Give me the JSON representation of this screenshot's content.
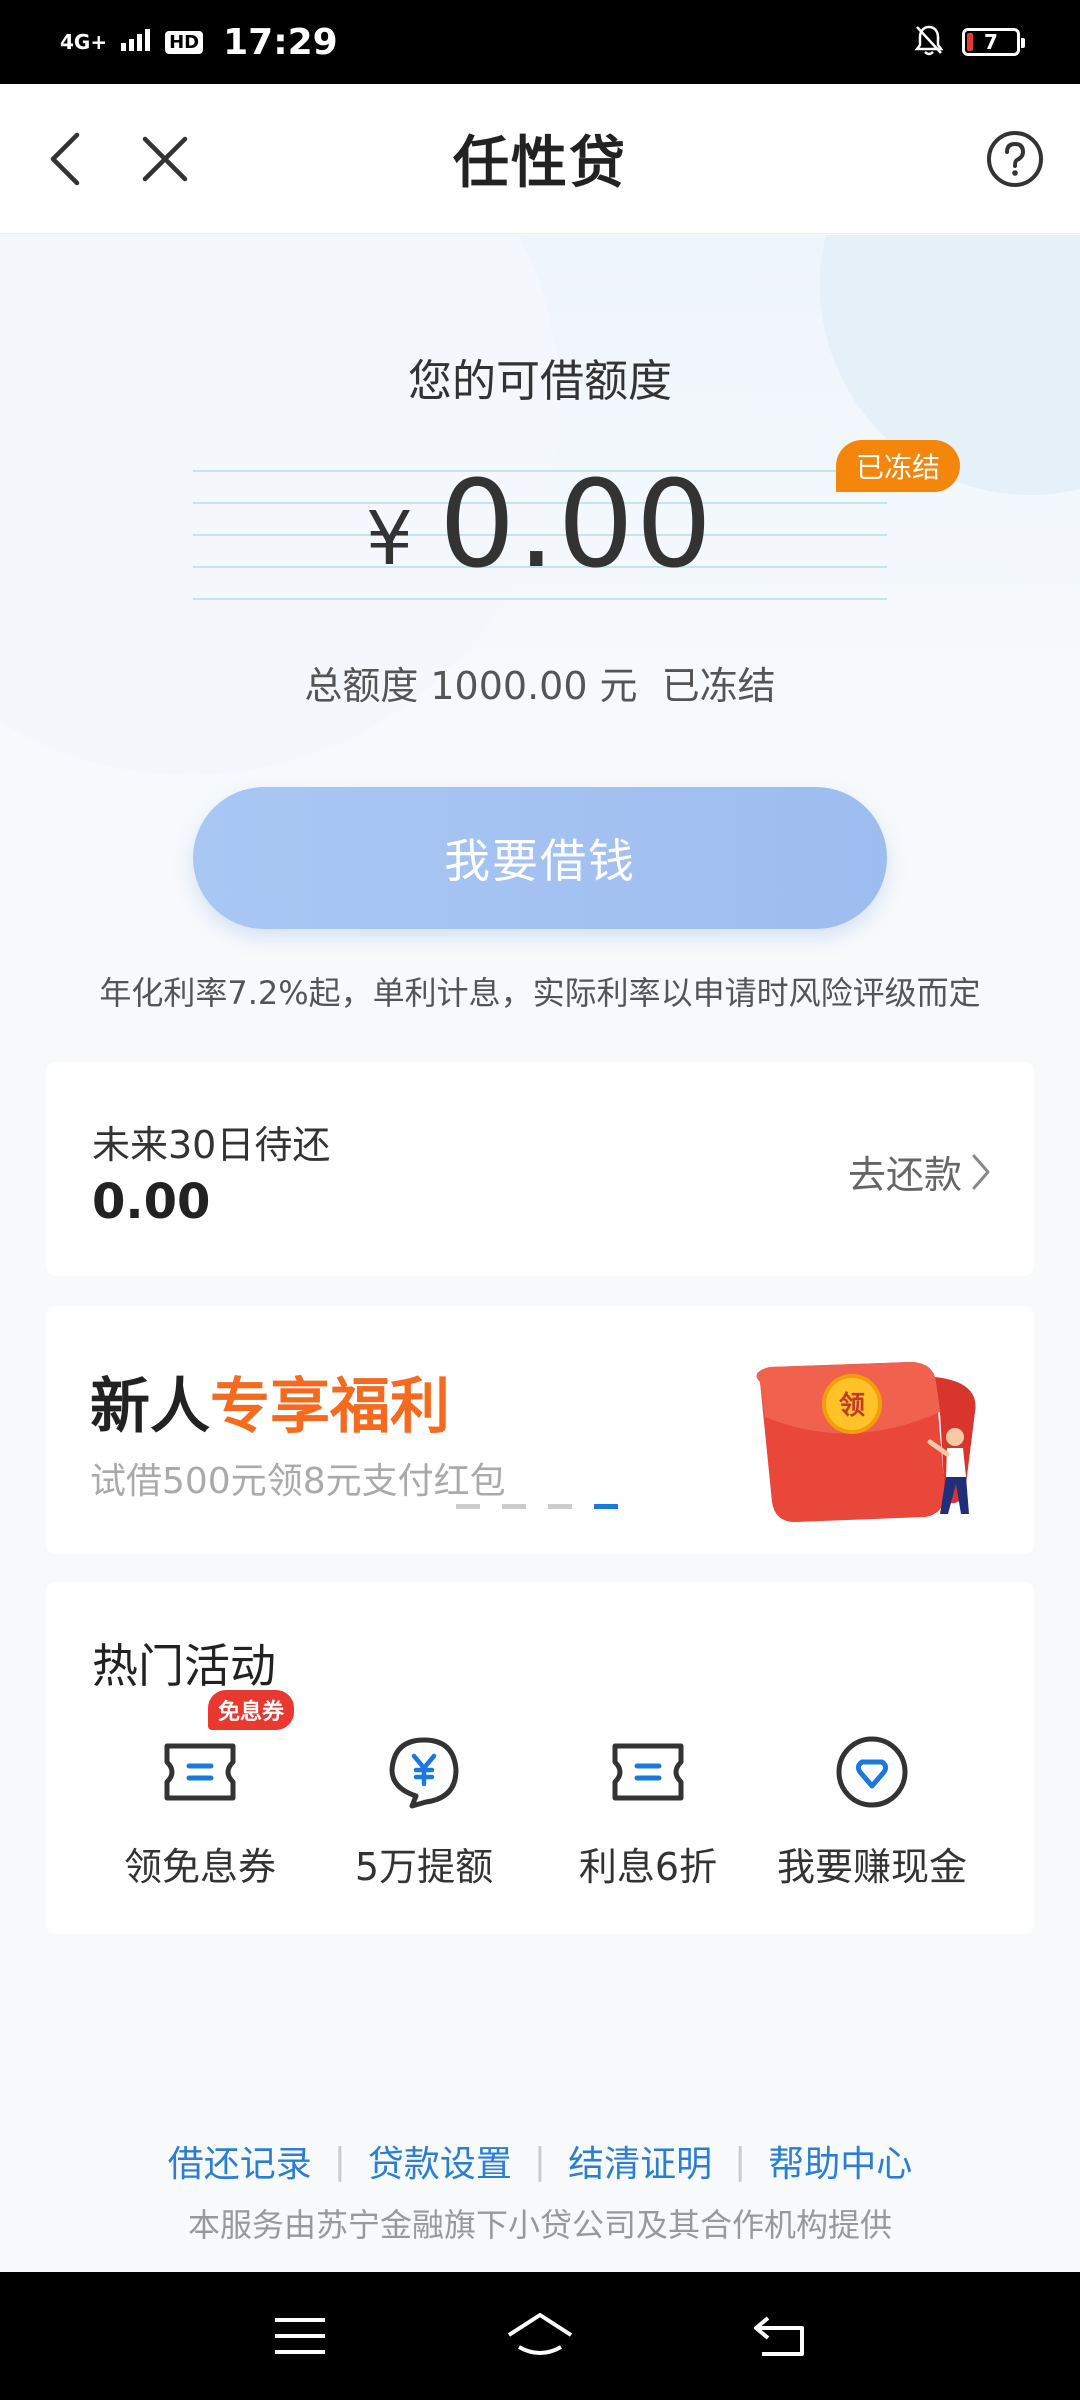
{
  "status_bar": {
    "network": "4G+",
    "hd": "HD",
    "time": "17:29",
    "battery": "7"
  },
  "header": {
    "title": "任性贷"
  },
  "hero": {
    "quota_label": "您的可借额度",
    "currency": "¥",
    "amount": "0.00",
    "badge": "已冻结",
    "total_prefix": "总额度",
    "total_amount": "1000.00",
    "total_unit": "元",
    "total_status": "已冻结",
    "borrow_button": "我要借钱",
    "rate_note": "年化利率7.2%起，单利计息，实际利率以申请时风险评级而定"
  },
  "repay": {
    "label": "未来30日待还",
    "amount": "0.00",
    "link": "去还款"
  },
  "banner": {
    "title_part1": "新人",
    "title_part2": "专享福利",
    "subtitle": "试借500元领8元支付红包",
    "envelope_text": "领",
    "active_dot": 4,
    "dot_count": 4
  },
  "hot": {
    "title": "热门活动",
    "items": [
      {
        "label": "领免息券",
        "badge": "免息券",
        "icon": "ticket-icon"
      },
      {
        "label": "5万提额",
        "icon": "yen-chat-icon"
      },
      {
        "label": "利息6折",
        "icon": "ticket-icon"
      },
      {
        "label": "我要赚现金",
        "icon": "heart-circle-icon"
      }
    ]
  },
  "footer": {
    "links": [
      "借还记录",
      "贷款设置",
      "结清证明",
      "帮助中心"
    ],
    "note": "本服务由苏宁金融旗下小贷公司及其合作机构提供"
  },
  "colors": {
    "accent_blue": "#2a7fd4",
    "orange": "#f5860c",
    "borrow_button": "#a9c7f3",
    "badge_red": "#e8382f"
  }
}
